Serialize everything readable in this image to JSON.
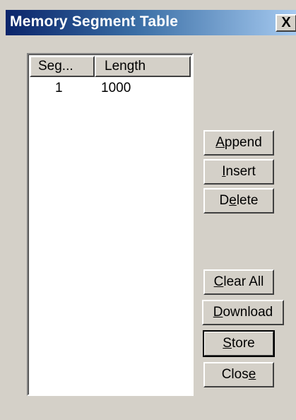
{
  "window": {
    "title": "Memory Segment  Table",
    "close_label": "X"
  },
  "list": {
    "columns": [
      "Seg...",
      "Length"
    ],
    "rows": [
      {
        "segment": "1",
        "length": "1000"
      }
    ]
  },
  "buttons": {
    "append": {
      "before": "",
      "key": "A",
      "after": "ppend"
    },
    "insert": {
      "before": "",
      "key": "I",
      "after": "nsert"
    },
    "delete": {
      "before": "D",
      "key": "e",
      "after": "lete"
    },
    "clear_all": {
      "before": "",
      "key": "C",
      "after": "lear All"
    },
    "download": {
      "before": "",
      "key": "D",
      "after": "ownload"
    },
    "store": {
      "before": "",
      "key": "S",
      "after": "tore"
    },
    "close": {
      "before": "Clos",
      "key": "e",
      "after": ""
    }
  },
  "colors": {
    "title_start": "#0a246a",
    "title_end": "#a6caf0",
    "face": "#d4d0c8"
  }
}
